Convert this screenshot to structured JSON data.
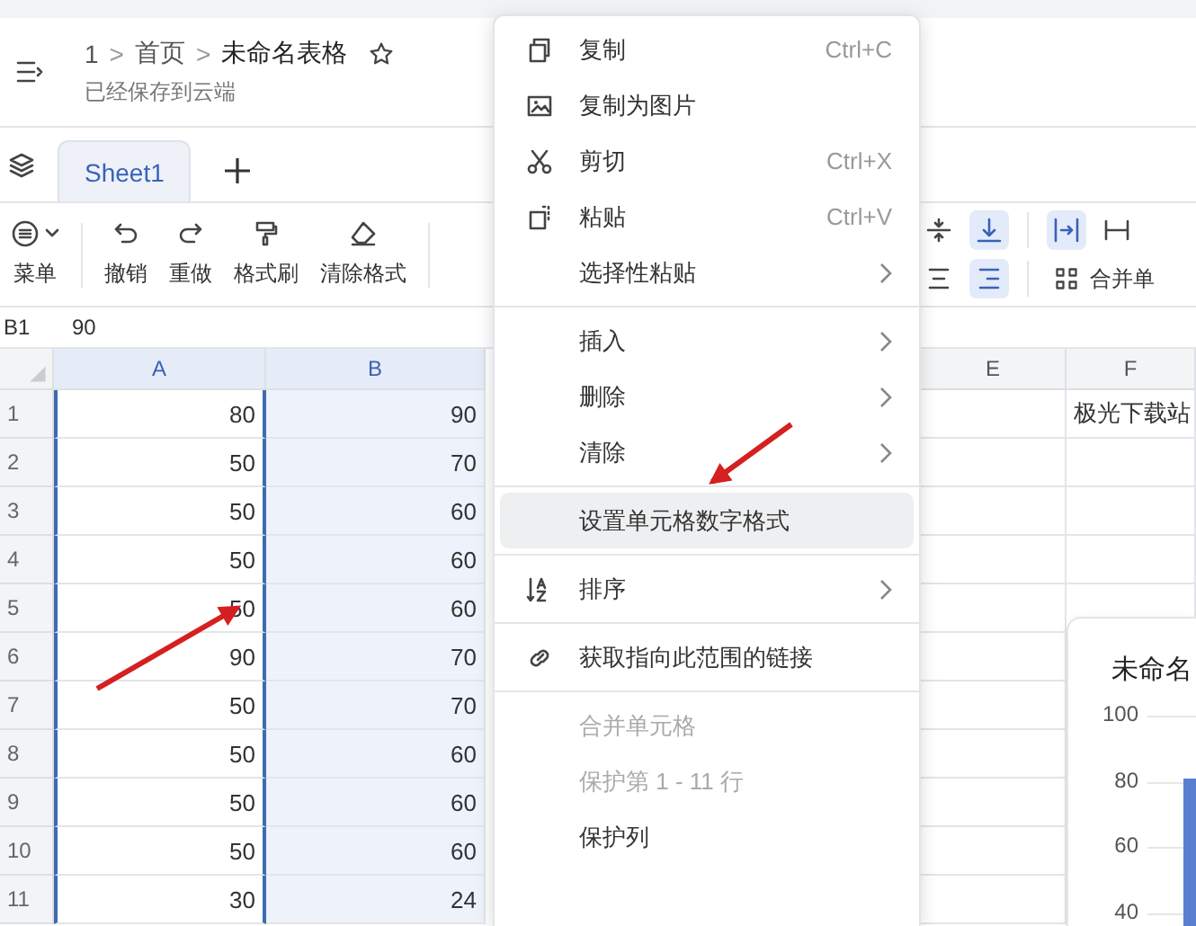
{
  "header": {
    "breadcrumb": [
      {
        "kind": "crumb",
        "text": "1"
      },
      {
        "kind": "sep",
        "text": ">"
      },
      {
        "kind": "crumb",
        "text": "首页"
      },
      {
        "kind": "sep",
        "text": ">"
      },
      {
        "kind": "title",
        "text": "未命名表格"
      }
    ],
    "starred": false,
    "save_status": "已经保存到云端"
  },
  "sheet_tabs": [
    {
      "label": "Sheet1",
      "selected": true
    }
  ],
  "toolbar": {
    "left": [
      {
        "kind": "button",
        "label": "菜单",
        "dropdown": true
      },
      {
        "kind": "divider"
      },
      {
        "kind": "button",
        "label": "撤销",
        "dropdown": false
      },
      {
        "kind": "button",
        "label": "重做",
        "dropdown": false
      },
      {
        "kind": "button",
        "label": "格式刷",
        "dropdown": false
      },
      {
        "kind": "button",
        "label": "清除格式",
        "dropdown": false
      },
      {
        "kind": "divider"
      }
    ],
    "right_top": [
      {
        "kind": "button",
        "selected": false
      },
      {
        "kind": "button",
        "selected": true
      },
      {
        "kind": "divider"
      },
      {
        "kind": "button",
        "selected": true
      },
      {
        "kind": "button",
        "selected": false
      }
    ],
    "right_bottom": [
      {
        "kind": "button",
        "selected": false
      },
      {
        "kind": "button",
        "selected": true
      },
      {
        "kind": "divider"
      },
      {
        "kind": "labeled",
        "label": "合并单",
        "selected": false
      }
    ]
  },
  "formula_bar": {
    "cell": "B1",
    "value": "90"
  },
  "sheet": {
    "columns": [
      {
        "label": "A",
        "selected": true
      },
      {
        "label": "B",
        "selected": true
      },
      {
        "label": "E",
        "selected": false
      },
      {
        "label": "F",
        "selected": false
      }
    ],
    "rows": [
      {
        "number": "1",
        "a": "80",
        "b": "90",
        "f": "极光下载站"
      },
      {
        "number": "2",
        "a": "50",
        "b": "70"
      },
      {
        "number": "3",
        "a": "50",
        "b": "60"
      },
      {
        "number": "4",
        "a": "50",
        "b": "60"
      },
      {
        "number": "5",
        "a": "50",
        "b": "60"
      },
      {
        "number": "6",
        "a": "90",
        "b": "70"
      },
      {
        "number": "7",
        "a": "50",
        "b": "70"
      },
      {
        "number": "8",
        "a": "50",
        "b": "60"
      },
      {
        "number": "9",
        "a": "50",
        "b": "60"
      },
      {
        "number": "10",
        "a": "50",
        "b": "60"
      },
      {
        "number": "11",
        "a": "30",
        "b": "24"
      }
    ]
  },
  "chart": {
    "title": "未命名",
    "y_ticks": [
      "100",
      "80",
      "60",
      "40"
    ]
  },
  "context_menu": {
    "items": [
      {
        "kind": "item",
        "label": "复制",
        "shortcut": "Ctrl+C",
        "submenu": false,
        "highlighted": false,
        "disabled": false
      },
      {
        "kind": "item",
        "label": "复制为图片",
        "submenu": false,
        "highlighted": false,
        "disabled": false
      },
      {
        "kind": "item",
        "label": "剪切",
        "shortcut": "Ctrl+X",
        "submenu": false,
        "highlighted": false,
        "disabled": false
      },
      {
        "kind": "item",
        "label": "粘贴",
        "shortcut": "Ctrl+V",
        "submenu": false,
        "highlighted": false,
        "disabled": false
      },
      {
        "kind": "item",
        "label": "选择性粘贴",
        "submenu": true,
        "highlighted": false,
        "disabled": false
      },
      {
        "kind": "divider"
      },
      {
        "kind": "item",
        "label": "插入",
        "submenu": true,
        "highlighted": false,
        "disabled": false
      },
      {
        "kind": "item",
        "label": "删除",
        "submenu": true,
        "highlighted": false,
        "disabled": false
      },
      {
        "kind": "item",
        "label": "清除",
        "submenu": true,
        "highlighted": false,
        "disabled": false
      },
      {
        "kind": "divider"
      },
      {
        "kind": "item",
        "label": "设置单元格数字格式",
        "submenu": false,
        "highlighted": true,
        "disabled": false
      },
      {
        "kind": "divider"
      },
      {
        "kind": "item",
        "label": "排序",
        "submenu": true,
        "highlighted": false,
        "disabled": false
      },
      {
        "kind": "divider"
      },
      {
        "kind": "item",
        "label": "获取指向此范围的链接",
        "submenu": false,
        "highlighted": false,
        "disabled": false
      },
      {
        "kind": "divider"
      },
      {
        "kind": "item",
        "label": "合并单元格",
        "submenu": false,
        "highlighted": false,
        "disabled": true
      },
      {
        "kind": "item",
        "label": "保护第 1 - 11 行",
        "submenu": false,
        "highlighted": false,
        "disabled": true
      },
      {
        "kind": "item",
        "label": "保护列",
        "submenu": false,
        "highlighted": false,
        "disabled": false
      }
    ]
  }
}
